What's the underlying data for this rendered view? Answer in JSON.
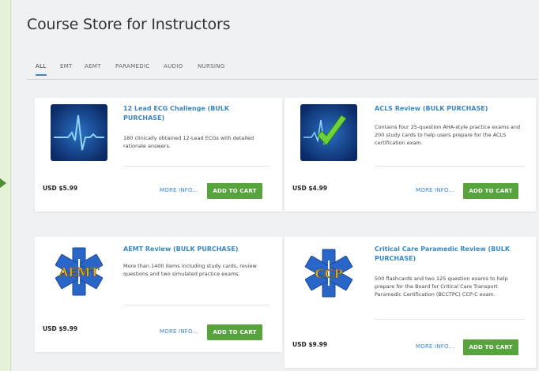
{
  "page": {
    "title": "Course Store for Instructors"
  },
  "tabs": [
    "ALL",
    "EMT",
    "AEMT",
    "PARAMEDIC",
    "AUDIO",
    "NURSING"
  ],
  "active_tab": "ALL",
  "products": [
    {
      "title": "12 Lead ECG Challenge (BULK PURCHASE)",
      "description": "180 clinically obtained 12-Lead ECGs with detailed rationale answers.",
      "price": "USD $5.99",
      "more_label": "MORE INFO...",
      "cart_label": "ADD TO CART",
      "thumb_icon": "ecg-heartbeat-icon"
    },
    {
      "title": "ACLS Review (BULK PURCHASE)",
      "description": "Contains four 25-question AHA-style practice exams and 200 study cards to help users prepare for the ACLS certification exam.",
      "price": "USD $4.99",
      "more_label": "MORE INFO...",
      "cart_label": "ADD TO CART",
      "thumb_icon": "acls-checkmark-icon"
    },
    {
      "title": "AEMT Review (BULK PURCHASE)",
      "description": "More than 1400 items including study cards, review questions and two simulated practice exams.",
      "price": "USD $9.99",
      "more_label": "MORE INFO...",
      "cart_label": "ADD TO CART",
      "thumb_icon": "aemt-star-of-life-icon",
      "thumb_text": "AEMT"
    },
    {
      "title": "Critical Care Paramedic Review (BULK PURCHASE)",
      "description": "500 flashcards and two 125 question exams to help prepare for the Board for Critical Care Transport Paramedic Certification (BCCTPC) CCP-C exam.",
      "price": "USD $9.99",
      "more_label": "MORE INFO...",
      "cart_label": "ADD TO CART",
      "thumb_icon": "ccp-star-of-life-icon",
      "thumb_text": "CCP"
    }
  ],
  "colors": {
    "accent": "#3a87c5",
    "button": "#57a33e",
    "page_bg": "#f0f1f3",
    "outer_bg": "#e6f2d8"
  }
}
